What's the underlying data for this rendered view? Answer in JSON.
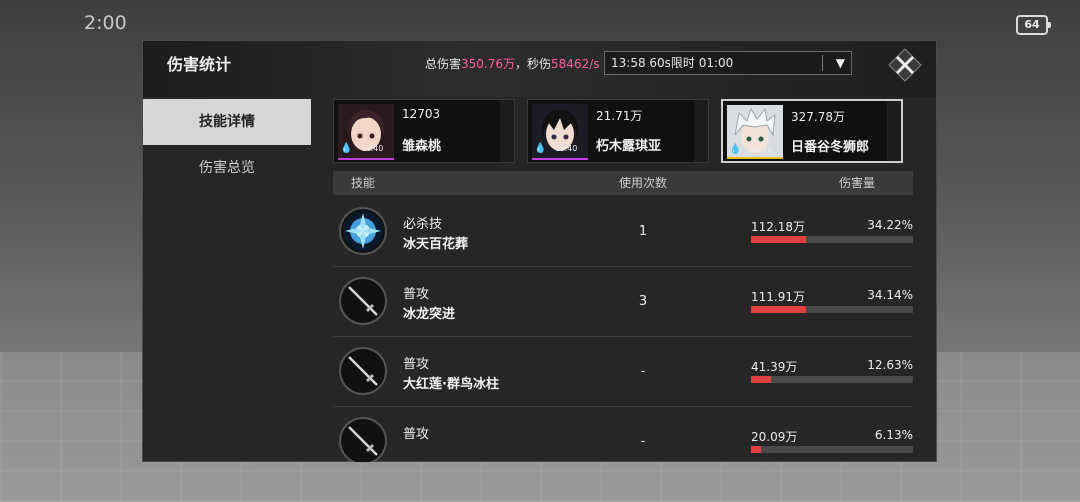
{
  "status_bar": {
    "time": "2:00",
    "battery": "64"
  },
  "panel": {
    "title": "伤害统计",
    "total_damage_label": "总伤害",
    "total_damage_value": "350.76万",
    "dps_label": "，秒伤",
    "dps_value": "58462/s",
    "dropdown_value": "13:58 60s限时 01:00"
  },
  "tabs": [
    {
      "label": "技能详情",
      "active": true
    },
    {
      "label": "伤害总览",
      "active": false
    }
  ],
  "characters": [
    {
      "damage": "12703",
      "name": "雏森桃",
      "level": "Lv.40",
      "level_color": "#c040e0",
      "selected": false
    },
    {
      "damage": "21.71万",
      "name": "朽木露琪亚",
      "level": "Lv.40",
      "level_color": "#c040e0",
      "selected": false
    },
    {
      "damage": "327.78万",
      "name": "日番谷冬狮郎",
      "level": "Lv.70",
      "level_color": "#e0c020",
      "selected": true
    }
  ],
  "table": {
    "headers": {
      "skill": "技能",
      "uses": "使用次数",
      "damage": "伤害量"
    },
    "rows": [
      {
        "type": "必杀技",
        "name": "冰天百花葬",
        "uses": "1",
        "damage": "112.18万",
        "percent": "34.22%",
        "fraction": 0.3422
      },
      {
        "type": "普攻",
        "name": "冰龙突进",
        "uses": "3",
        "damage": "111.91万",
        "percent": "34.14%",
        "fraction": 0.3414
      },
      {
        "type": "普攻",
        "name": "大红莲·群鸟冰柱",
        "uses": "-",
        "damage": "41.39万",
        "percent": "12.63%",
        "fraction": 0.1263
      },
      {
        "type": "普攻",
        "name": "",
        "uses": "-",
        "damage": "20.09万",
        "percent": "6.13%",
        "fraction": 0.0613
      }
    ]
  },
  "colors": {
    "accent_pink": "#ff5fa0",
    "bar_red": "#e04040"
  }
}
